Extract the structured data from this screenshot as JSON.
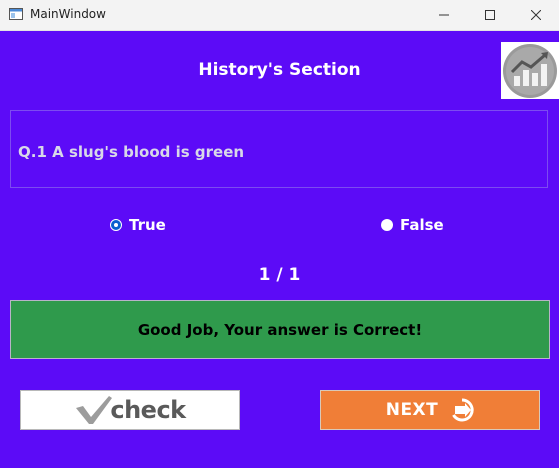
{
  "window": {
    "title": "MainWindow"
  },
  "header": {
    "section_title": "History's Section",
    "logo_icon": "chart-growth-icon"
  },
  "question": {
    "text": "Q.1  A slug's blood is green"
  },
  "options": [
    {
      "label": "True",
      "selected": true
    },
    {
      "label": "False",
      "selected": false
    }
  ],
  "progress": {
    "current": 1,
    "total": 1,
    "text": "1 / 1"
  },
  "result": {
    "message": "Good Job, Your answer is Correct!",
    "color": "#2f9a4c"
  },
  "buttons": {
    "check_label": "check",
    "check_icon": "checkmark-icon",
    "next_label": "NEXT",
    "next_icon": "arrow-right-icon",
    "next_color": "#f07e37"
  },
  "theme": {
    "background": "#5c0bf7"
  }
}
